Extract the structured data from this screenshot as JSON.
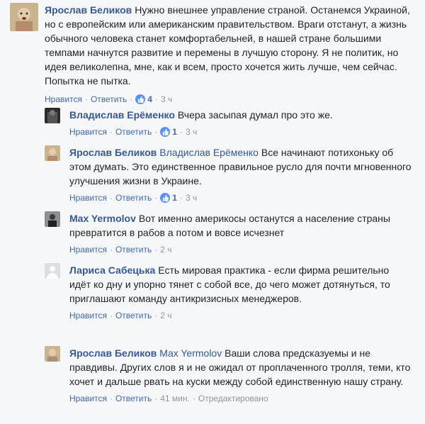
{
  "ui": {
    "like": "Нравится",
    "reply": "Ответить",
    "sep": "·"
  },
  "comments": [
    {
      "author": "Ярослав Беликов",
      "text": "Нужно внешнее управление страной. Останемся Украиной, но с европейским или американским правительством. Враги отстанут, а жизнь обычного человека станет комфортабельней, в нашей стране большими темпами начнутся развитие и перемены в лучшую сторону. Я не политик, но идея великолепна, мне, как и всем, просто хочется жить лучше, чем сейчас. Попытка не пытка.",
      "likes": "4",
      "time": "3 ч"
    },
    {
      "author": "Владислав Ерёменко",
      "text": "Вчера засыпая думал про это же.",
      "likes": "1",
      "time": "3 ч"
    },
    {
      "author": "Ярослав Беликов",
      "mention": "Владислав Ерёменко",
      "text": "Все начинают потихоньку об этом думать. Это единственное правильное русло для почти мгновенного улучшения жизни в Украине.",
      "likes": "1",
      "time": "3 ч"
    },
    {
      "author": "Max Yermolov",
      "text": "Вот именно америкосы останутся а население страны превратится в рабов а потом и вовсе исчезнет",
      "time": "2 ч"
    },
    {
      "author": "Лариса Сабецька",
      "text": "Есть мировая практика - если фирма решительно идёт ко дну и упорно тянет с собой все, до чего может дотянуться, то приглашают команду антикризисных менеджеров.",
      "time": "2 ч"
    },
    {
      "author": "Ярослав Беликов",
      "mention": "Max Yermolov",
      "text": "Ваши слова предсказуемы и не правдивы. Других слов я и не ожидал от проплаченного тролля, теми, кто хочет и дальше рвать на куски между собой единственную нашу страну.",
      "time": "41 мин.",
      "edited": "Отредактировано"
    }
  ]
}
